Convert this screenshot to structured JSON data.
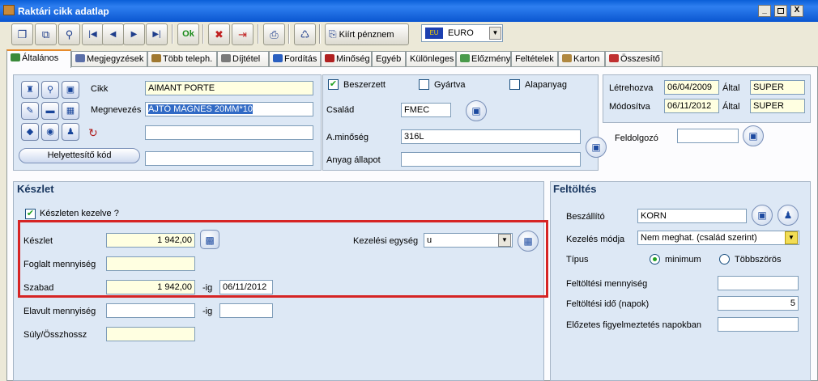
{
  "window": {
    "title": "Raktári cikk adatlap",
    "min": "_",
    "max": "□",
    "close": "X"
  },
  "toolbar": {
    "buttons": [
      {
        "name": "new-record-button",
        "glyph": "❐"
      },
      {
        "name": "copy-record-button",
        "glyph": "⧉"
      },
      {
        "name": "search-tool-button",
        "glyph": "⚲"
      },
      {
        "name": "first-record-button",
        "glyph": "|◀"
      },
      {
        "name": "previous-record-button",
        "glyph": "◀"
      },
      {
        "name": "next-record-button",
        "glyph": "▶"
      },
      {
        "name": "last-record-button",
        "glyph": "▶|"
      },
      {
        "name": "ok-button",
        "glyph": "Ok"
      },
      {
        "name": "delete-button",
        "glyph": "✖"
      },
      {
        "name": "exit-button",
        "glyph": "⇥"
      },
      {
        "name": "print-button",
        "glyph": "⎙"
      },
      {
        "name": "clear-button",
        "glyph": "♺"
      }
    ],
    "currency_button_label": "Kiírt pénznem",
    "currency_flag": "EU",
    "currency_value": "EURO"
  },
  "tabs": [
    {
      "label": "Általános",
      "color": "#3a8a3a"
    },
    {
      "label": "Megjegyzések",
      "color": "#5b6fa8"
    },
    {
      "label": "Több teleph.",
      "color": "#a07830"
    },
    {
      "label": "Díjtétel",
      "color": "#7a7a7a"
    },
    {
      "label": "Fordítás",
      "color": "#2a5fc0"
    },
    {
      "label": "Minőség",
      "color": "#b02020"
    },
    {
      "label": "Egyéb",
      "color": ""
    },
    {
      "label": "Különleges",
      "color": ""
    },
    {
      "label": "Előzmény",
      "color": "#4a9a4a"
    },
    {
      "label": "Feltételek",
      "color": ""
    },
    {
      "label": "Karton",
      "color": "#b08840"
    },
    {
      "label": "Összesítő",
      "color": "#c03030"
    }
  ],
  "article": {
    "cikk_label": "Cikk",
    "cikk_value": "AIMANT PORTE",
    "megnevezes_label": "Megnevezés",
    "megnevezes_value": "AJTÓ MÁGNES 20MM*10",
    "extra1_value": "",
    "extra2_value": "",
    "substitute_button": "Helyettesítő kód"
  },
  "flags": {
    "beszerzett": "Beszerzett",
    "beszerzett_checked": true,
    "gyartva": "Gyártva",
    "gyartva_checked": false,
    "alapanyag": "Alapanyag",
    "alapanyag_checked": false,
    "csalad_label": "Család",
    "csalad_value": "FMEC",
    "aminoseg_label": "A.minőség",
    "aminoseg_value": "316L",
    "allapot_label": "Anyag állapot",
    "allapot_value": "",
    "feldolgozo_label": "Feldolgozó",
    "feldolgozo_value": ""
  },
  "audit": {
    "letrehozva_label": "Létrehozva",
    "letrehozva_value": "06/04/2009",
    "modositva_label": "Módosítva",
    "modositva_value": "06/11/2012",
    "altal_label": "Által",
    "letrehozva_by": "SUPER",
    "modositva_by": "SUPER"
  },
  "keszlet": {
    "title": "Készlet",
    "kezelve_label": "Készleten kezelve ?",
    "kezelve_checked": true,
    "keszlet_label": "Készlet",
    "keszlet_value": "1 942,00",
    "kezelesi_label": "Kezelési egység",
    "kezelesi_value": "u",
    "foglalt_label": "Foglalt mennyiség",
    "foglalt_value": "",
    "szabad_label": "Szabad",
    "szabad_value": "1 942,00",
    "ig_label": "-ig",
    "szabad_date": "06/11/2012",
    "elavult_label": "Elavult mennyiség",
    "elavult_value": "",
    "elavult_date": "",
    "suly_label": "Súly/Összhossz",
    "suly_value": ""
  },
  "feltoltes": {
    "title": "Feltöltés",
    "beszallito_label": "Beszállító",
    "beszallito_value": "KORN",
    "kezelesmod_label": "Kezelés módja",
    "kezelesmod_value": "Nem meghat. (család szerint)",
    "tipus_label": "Típus",
    "minimum_label": "minimum",
    "tobbszoros_label": "Többszörös",
    "mennyiseg_label": "Feltöltési mennyiség",
    "mennyiseg_value": "",
    "ido_label": "Feltöltési idő (napok)",
    "ido_value": "5",
    "figyelmeztetes_label": "Előzetes figyelmeztetés napokban",
    "figyelmeztetes_value": ""
  },
  "highlight_color": "#d62424"
}
